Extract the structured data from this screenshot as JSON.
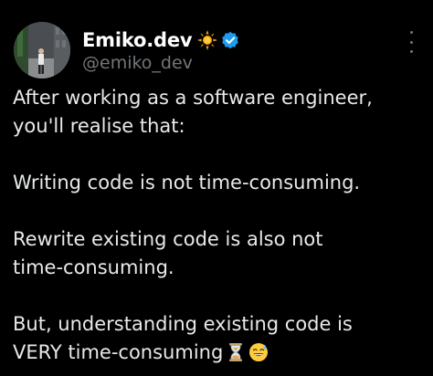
{
  "author": {
    "display_name": "Emiko.dev",
    "handle": "@emiko_dev",
    "badge_emoji": "sun-emoji",
    "verified": true,
    "verified_color": "#1d9bf0"
  },
  "post": {
    "para1_line1": "After working as a software engineer,",
    "para1_line2": "you'll realise that:",
    "para2_line1": "Writing code is not time-consuming.",
    "para3_line1": "Rewrite existing code is also not",
    "para3_line2": "time-consuming.",
    "para4_line1": "But, understanding existing code is",
    "para4_line2": "VERY time-consuming",
    "trailing_emojis": [
      "hourglass-emoji",
      "sweat-smile-emoji"
    ]
  },
  "colors": {
    "background": "#000000",
    "text": "#e7e9ea",
    "secondary_text": "#71767b"
  }
}
